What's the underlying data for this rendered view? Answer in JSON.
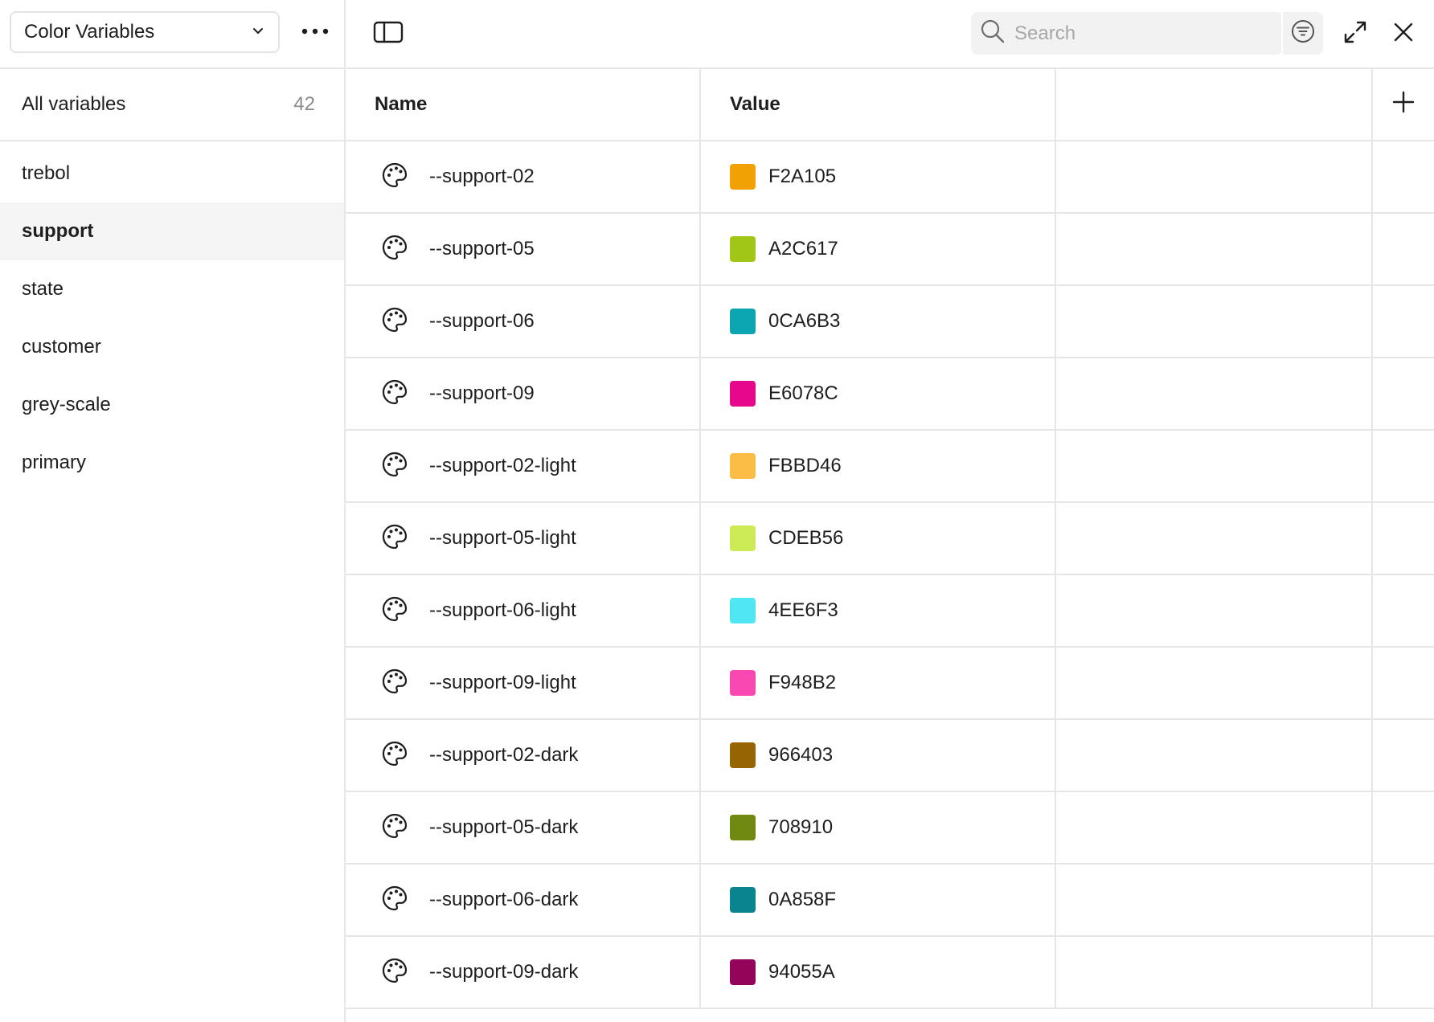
{
  "sidebar": {
    "collection_label": "Color Variables",
    "all_variables_label": "All variables",
    "all_variables_count": "42",
    "groups": [
      {
        "label": "trebol"
      },
      {
        "label": "support"
      },
      {
        "label": "state"
      },
      {
        "label": "customer"
      },
      {
        "label": "grey-scale"
      },
      {
        "label": "primary"
      }
    ],
    "active_group": "support"
  },
  "toolbar": {
    "search_placeholder": "Search",
    "icons": [
      "chevron-down-icon",
      "more-horizontal-icon",
      "sidebar-panel-icon",
      "search-icon",
      "filter-icon",
      "expand-icon",
      "close-icon",
      "plus-icon"
    ]
  },
  "table": {
    "headers": {
      "name": "Name",
      "value": "Value"
    },
    "rows": [
      {
        "name": "--support-02",
        "hex": "F2A105",
        "color": "#F2A105"
      },
      {
        "name": "--support-05",
        "hex": "A2C617",
        "color": "#A2C617"
      },
      {
        "name": "--support-06",
        "hex": "0CA6B3",
        "color": "#0CA6B3"
      },
      {
        "name": "--support-09",
        "hex": "E6078C",
        "color": "#E6078C"
      },
      {
        "name": "--support-02-light",
        "hex": "FBBD46",
        "color": "#FBBD46"
      },
      {
        "name": "--support-05-light",
        "hex": "CDEB56",
        "color": "#CDEB56"
      },
      {
        "name": "--support-06-light",
        "hex": "4EE6F3",
        "color": "#4EE6F3"
      },
      {
        "name": "--support-09-light",
        "hex": "F948B2",
        "color": "#F948B2"
      },
      {
        "name": "--support-02-dark",
        "hex": "966403",
        "color": "#966403"
      },
      {
        "name": "--support-05-dark",
        "hex": "708910",
        "color": "#708910"
      },
      {
        "name": "--support-06-dark",
        "hex": "0A858F",
        "color": "#0A858F"
      },
      {
        "name": "--support-09-dark",
        "hex": "94055A",
        "color": "#94055A"
      }
    ]
  }
}
